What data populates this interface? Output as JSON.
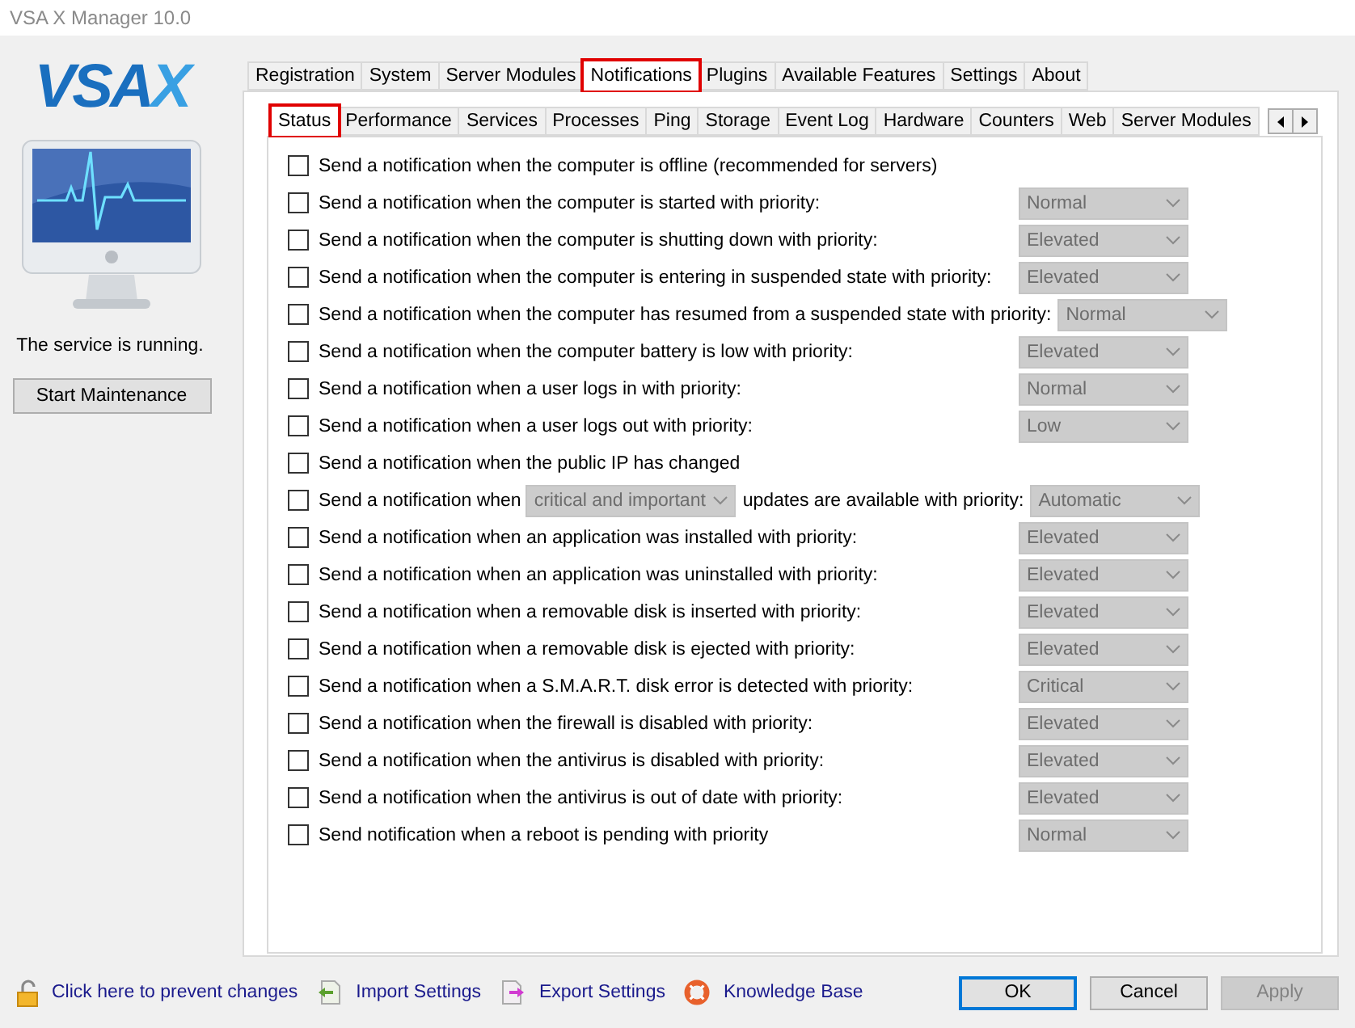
{
  "window": {
    "title": "VSA X Manager 10.0"
  },
  "logo": {
    "text": "VSA",
    "accent": "X"
  },
  "service_status": "The service is running.",
  "maintenance_button": "Start Maintenance",
  "tabs": [
    {
      "label": "Registration",
      "selected": false,
      "marked": false
    },
    {
      "label": "System",
      "selected": false,
      "marked": false
    },
    {
      "label": "Server Modules",
      "selected": false,
      "marked": false
    },
    {
      "label": "Notifications",
      "selected": true,
      "marked": true
    },
    {
      "label": "Plugins",
      "selected": false,
      "marked": false
    },
    {
      "label": "Available Features",
      "selected": false,
      "marked": false
    },
    {
      "label": "Settings",
      "selected": false,
      "marked": false
    },
    {
      "label": "About",
      "selected": false,
      "marked": false
    }
  ],
  "subtabs": [
    {
      "label": "Status",
      "selected": true,
      "marked": true
    },
    {
      "label": "Performance",
      "selected": false,
      "marked": false
    },
    {
      "label": "Services",
      "selected": false,
      "marked": false
    },
    {
      "label": "Processes",
      "selected": false,
      "marked": false
    },
    {
      "label": "Ping",
      "selected": false,
      "marked": false
    },
    {
      "label": "Storage",
      "selected": false,
      "marked": false
    },
    {
      "label": "Event Log",
      "selected": false,
      "marked": false
    },
    {
      "label": "Hardware",
      "selected": false,
      "marked": false
    },
    {
      "label": "Counters",
      "selected": false,
      "marked": false
    },
    {
      "label": "Web",
      "selected": false,
      "marked": false
    },
    {
      "label": "Server Modules",
      "selected": false,
      "marked": false
    }
  ],
  "notifications": [
    {
      "kind": "plain",
      "text": "Send a notification when the computer is offline (recommended for servers)",
      "checked": false
    },
    {
      "kind": "priority",
      "text": "Send a notification when the computer is started with priority:",
      "checked": false,
      "priority": "Normal"
    },
    {
      "kind": "priority",
      "text": "Send a notification when the computer is shutting down with priority:",
      "checked": false,
      "priority": "Elevated"
    },
    {
      "kind": "priority",
      "text": "Send a notification when the computer is entering in suspended state with priority:",
      "checked": false,
      "priority": "Elevated"
    },
    {
      "kind": "priority",
      "text": "Send a notification when the computer has resumed from a suspended state with priority:",
      "checked": false,
      "priority": "Normal"
    },
    {
      "kind": "priority",
      "text": "Send a notification when the computer battery is low with priority:",
      "checked": false,
      "priority": "Elevated"
    },
    {
      "kind": "priority",
      "text": "Send a notification when a user logs in with priority:",
      "checked": false,
      "priority": "Normal"
    },
    {
      "kind": "priority",
      "text": "Send a notification when a user logs out with priority:",
      "checked": false,
      "priority": "Low"
    },
    {
      "kind": "plain",
      "text": "Send a notification when the public IP has changed",
      "checked": false
    },
    {
      "kind": "updates",
      "text": "Send a notification when",
      "filter": "critical and important",
      "suffix": "updates are available with priority:",
      "checked": false,
      "priority": "Automatic"
    },
    {
      "kind": "priority",
      "text": "Send a notification when an application was installed with priority:",
      "checked": false,
      "priority": "Elevated"
    },
    {
      "kind": "priority",
      "text": "Send a notification when an application was uninstalled with priority:",
      "checked": false,
      "priority": "Elevated"
    },
    {
      "kind": "priority",
      "text": "Send a notification when a removable disk is inserted with priority:",
      "checked": false,
      "priority": "Elevated"
    },
    {
      "kind": "priority",
      "text": "Send a notification when a removable disk is ejected with priority:",
      "checked": false,
      "priority": "Elevated"
    },
    {
      "kind": "priority",
      "text": "Send a notification when a S.M.A.R.T. disk error is detected with priority:",
      "checked": false,
      "priority": "Critical"
    },
    {
      "kind": "priority",
      "text": "Send a notification when the firewall is disabled with priority:",
      "checked": false,
      "priority": "Elevated"
    },
    {
      "kind": "priority",
      "text": "Send a notification when the antivirus is disabled with priority:",
      "checked": false,
      "priority": "Elevated"
    },
    {
      "kind": "priority",
      "text": "Send a notification when the antivirus is out of date with priority:",
      "checked": false,
      "priority": "Elevated"
    },
    {
      "kind": "priority",
      "text": "Send notification when a reboot is pending with priority",
      "checked": false,
      "priority": "Normal"
    }
  ],
  "footer_links": [
    {
      "kind": "lock",
      "label": "Click here to prevent changes"
    },
    {
      "kind": "import",
      "label": "Import Settings"
    },
    {
      "kind": "export",
      "label": "Export Settings"
    },
    {
      "kind": "help",
      "label": "Knowledge Base"
    }
  ],
  "buttons": [
    {
      "label": "OK",
      "default": true,
      "disabled": false
    },
    {
      "label": "Cancel",
      "default": false,
      "disabled": false
    },
    {
      "label": "Apply",
      "default": false,
      "disabled": true
    }
  ]
}
